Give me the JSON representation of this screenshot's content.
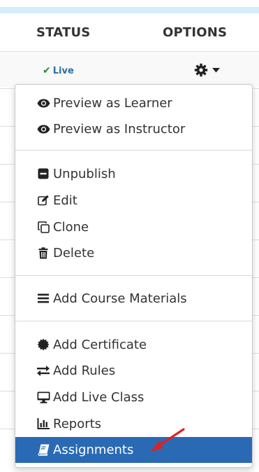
{
  "table": {
    "headers": {
      "status": "STATUS",
      "options": "OPTIONS"
    },
    "row": {
      "status_label": "Live",
      "status_icon": "check-icon"
    }
  },
  "menu": {
    "items": [
      {
        "label": "Preview as Learner",
        "icon": "eye-icon"
      },
      {
        "label": "Preview as Instructor",
        "icon": "eye-icon"
      },
      {
        "label": "Unpublish",
        "icon": "minus-square-icon"
      },
      {
        "label": "Edit",
        "icon": "edit-icon"
      },
      {
        "label": "Clone",
        "icon": "clone-icon"
      },
      {
        "label": "Delete",
        "icon": "trash-icon"
      },
      {
        "label": "Add Course Materials",
        "icon": "bars-icon"
      },
      {
        "label": "Add Certificate",
        "icon": "certificate-icon"
      },
      {
        "label": "Add Rules",
        "icon": "exchange-icon"
      },
      {
        "label": "Add Live Class",
        "icon": "desktop-icon"
      },
      {
        "label": "Reports",
        "icon": "bar-chart-icon"
      },
      {
        "label": "Assignments",
        "icon": "book-icon",
        "active": true
      }
    ]
  },
  "colors": {
    "active_bg": "#2a6ab5",
    "live_green": "#2d8a2d",
    "header_strip": "#d5ecfa",
    "arrow": "#e02020"
  }
}
